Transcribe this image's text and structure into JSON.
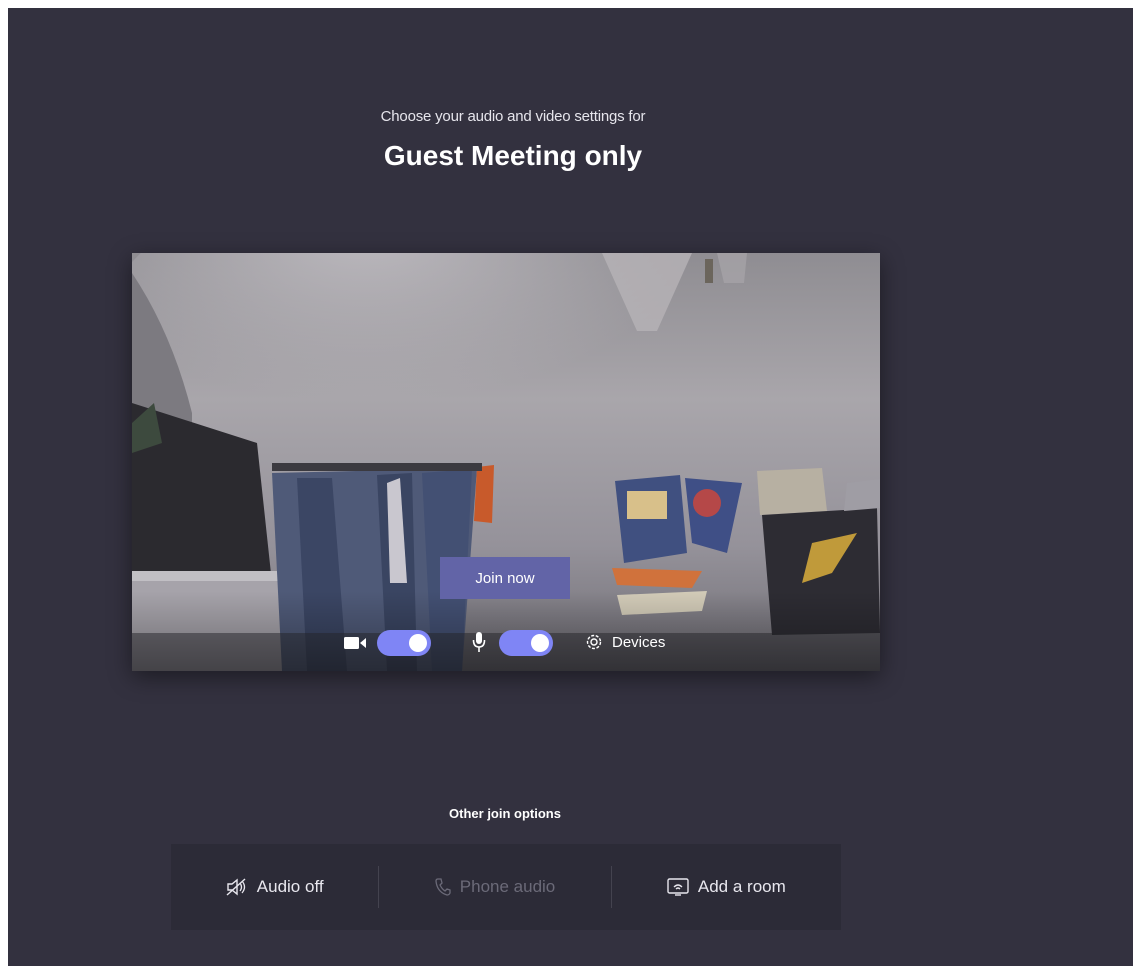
{
  "header": {
    "subtitle": "Choose your audio and video settings for",
    "meeting_title": "Guest Meeting only"
  },
  "preview": {
    "join_button_label": "Join now",
    "camera_icon": "video-camera-icon",
    "camera_toggle_on": true,
    "mic_icon": "microphone-icon",
    "mic_toggle_on": true,
    "devices_icon": "gear-icon",
    "devices_label": "Devices"
  },
  "other_options": {
    "heading": "Other join options",
    "items": [
      {
        "label": "Audio off",
        "icon": "speaker-off-icon",
        "enabled": true
      },
      {
        "label": "Phone audio",
        "icon": "phone-icon",
        "enabled": false
      },
      {
        "label": "Add a room",
        "icon": "cast-room-icon",
        "enabled": true
      }
    ]
  },
  "colors": {
    "background": "#33313f",
    "accent": "#6264a7",
    "toggle_on": "#7f85f5",
    "options_bar": "#2c2b37"
  }
}
